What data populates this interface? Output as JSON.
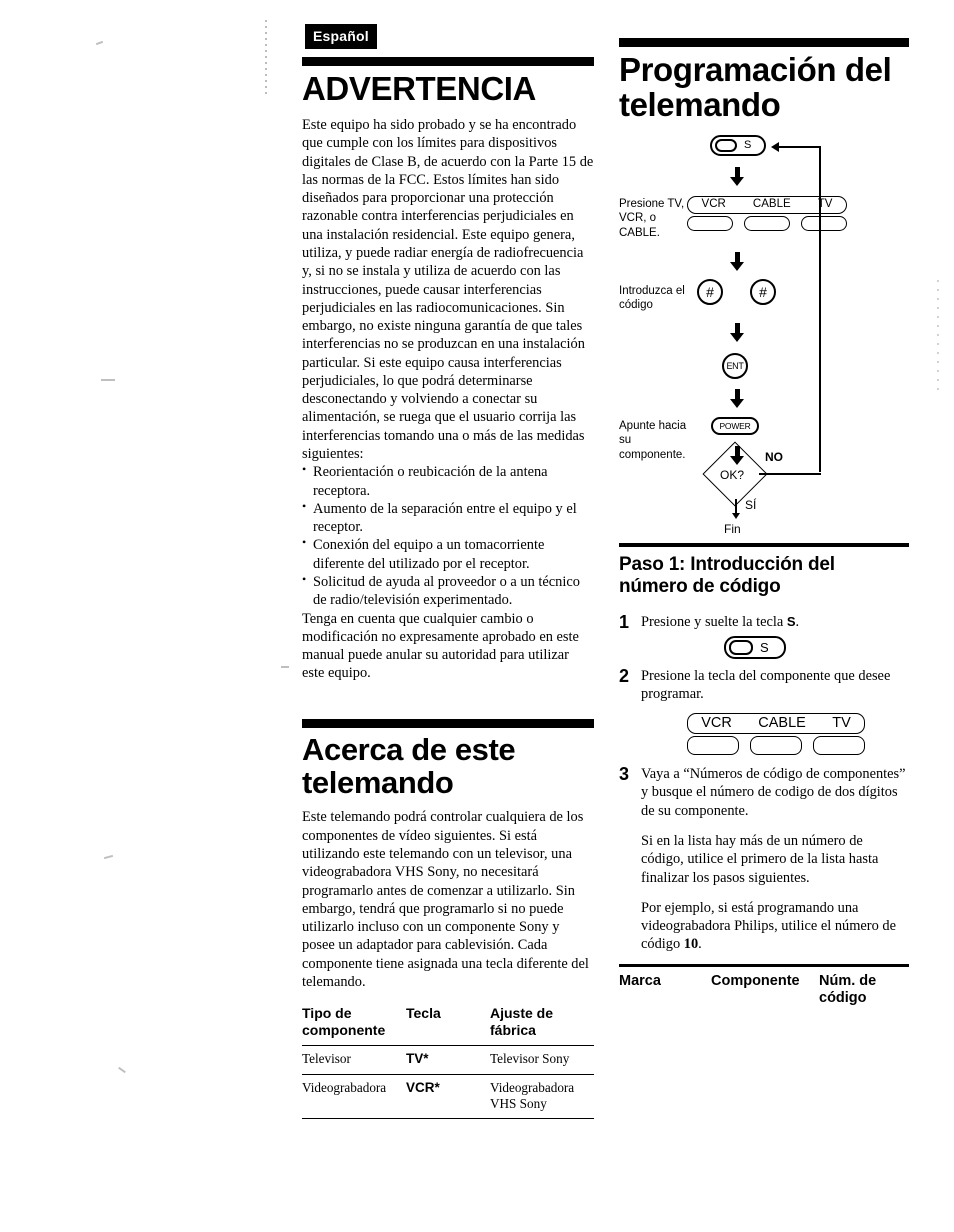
{
  "page": {
    "language_tag": "Español"
  },
  "left_column": {
    "warning_section": {
      "title": "ADVERTENCIA",
      "paragraph_1": "Este equipo ha sido probado y se ha encontrado que cumple con los límites para dispositivos digitales de Clase B, de acuerdo con la Parte 15 de las normas de la FCC.  Estos límites han sido diseñados para proporcionar una protección razonable contra interferencias perjudiciales en una instalación residencial.  Este equipo genera, utiliza, y puede radiar energía de radiofrecuencia y, si no se instala y utiliza de acuerdo con las instrucciones, puede causar interferencias perjudiciales en las radiocomunicaciones.  Sin embargo, no existe ninguna garantía de que tales interferencias no se produzcan en una instalación particular.  Si este equipo causa interferencias perjudiciales, lo que podrá determinarse desconectando y volviendo a conectar su alimentación, se ruega que el usuario corrija las interferencias tomando una o más de las medidas siguientes:",
      "bullets": [
        "Reorientación o reubicación de la antena receptora.",
        "Aumento de la separación entre el equipo y el receptor.",
        "Conexión del equipo a un tomacorriente diferente del utilizado por el receptor.",
        "Solicitud de ayuda al proveedor o a un técnico de radio/televisión experimentado."
      ],
      "paragraph_2": "Tenga en cuenta que cualquier cambio o modificación no expresamente aprobado en este manual puede anular su autoridad para utilizar este equipo."
    },
    "about_section": {
      "title_line_1": "Acerca de este",
      "title_line_2": "telemando",
      "paragraph_1": "Este telemando podrá controlar cualquiera de los componentes de vídeo siguientes.  Si está utilizando este telemando con un televisor, una videograbadora VHS Sony, no necesitará programarlo antes de comenzar a utilizarlo.  Sin embargo, tendrá que programarlo si no puede utilizarlo incluso con un componente Sony y posee un adaptador para cablevisión.  Cada componente tiene asignada una tecla diferente del telemando.",
      "table": {
        "headers": [
          "Tipo de componente",
          "Tecla",
          "Ajuste de fábrica"
        ],
        "rows": [
          [
            "Televisor",
            "TV*",
            "Televisor Sony"
          ],
          [
            "Videograbadora",
            "VCR*",
            "Videograbadora VHS Sony"
          ]
        ]
      }
    }
  },
  "right_column": {
    "programming_section": {
      "title_line_1": "Programación del",
      "title_line_2": "telemando",
      "flowchart": {
        "start_key": "S",
        "step_labels": {
          "press_component": "Presione TV, VCR, o CABLE.",
          "enter_code": "Introduzca el código",
          "point_remote": "Apunte hacia su componente."
        },
        "component_keys": [
          "VCR",
          "CABLE",
          "TV"
        ],
        "code_keys": [
          "#",
          "#"
        ],
        "enter_key": "ENT",
        "power_key": "POWER",
        "decision": "OK?",
        "branch_no": "NO",
        "branch_yes": "SÍ",
        "end": "Fin"
      }
    },
    "step_section": {
      "title_line_1": "Paso 1:  Introducción del",
      "title_line_2": "número de código",
      "steps": [
        {
          "number": "1",
          "text_before": "Presione y suelte la tecla ",
          "key": "S",
          "text_after": ".",
          "graphic_key": "S"
        },
        {
          "number": "2",
          "text": "Presione la tecla del componente que desee programar.",
          "component_keys": [
            "VCR",
            "CABLE",
            "TV"
          ]
        },
        {
          "number": "3",
          "paragraph_1": "Vaya a “Números de código de componentes” y busque el número de codigo de dos dígitos de su componente.",
          "paragraph_2": "Si en la lista hay más de un número de código, utilice el primero de la lista hasta finalizar los pasos siguientes.",
          "paragraph_3_before": "Por ejemplo, si está programando una videograbadora Philips, utilice el número de código ",
          "paragraph_3_code": "10",
          "paragraph_3_after": "."
        }
      ],
      "code_table": {
        "headers": [
          "Marca",
          "Componente",
          "Núm. de código"
        ]
      }
    }
  }
}
